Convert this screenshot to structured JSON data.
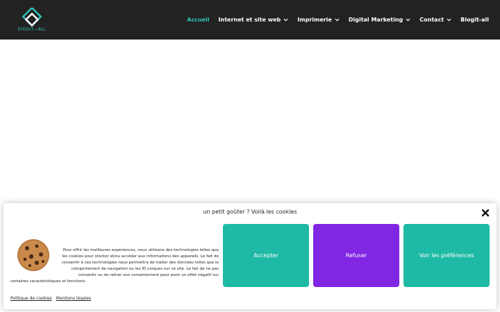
{
  "header": {
    "logo_text": "DIGGIT—ALL",
    "nav": [
      {
        "label": "Accueil",
        "active": true,
        "dropdown": false
      },
      {
        "label": "Internet et site web",
        "active": false,
        "dropdown": true
      },
      {
        "label": "Imprimerie",
        "active": false,
        "dropdown": true
      },
      {
        "label": "Digital Marketing",
        "active": false,
        "dropdown": true
      },
      {
        "label": "Contact",
        "active": false,
        "dropdown": true
      },
      {
        "label": "Blogit-all",
        "active": false,
        "dropdown": false
      }
    ]
  },
  "cookie_banner": {
    "title": "un petit goûter ? Voilà les cookies",
    "message_lines": [
      "Pour offrir les meilleures expériences, nous utilisons des technologies telles que",
      "les cookies pour stocker et/ou accéder aux informations des appareils. Le fait de",
      "consentir à ces technologies nous permettra de traiter des données telles que le",
      "comportement de navigation ou les ID uniques sur ce site. Le fait de ne pas",
      "consentir ou de retirer son consentement peut avoir un effet négatif sur",
      "certaines caractéristiques et fonctions."
    ],
    "buttons": {
      "accept": "Accepter",
      "refuse": "Refuser",
      "preferences": "Voir les préférences"
    },
    "links": {
      "cookie_policy": "Politique de cookies",
      "legal": "Mentions légales"
    }
  },
  "colors": {
    "header_bg": "#222222",
    "accent": "#2ec4b6",
    "accept": "#1fbaa5",
    "refuse": "#8126e3"
  }
}
